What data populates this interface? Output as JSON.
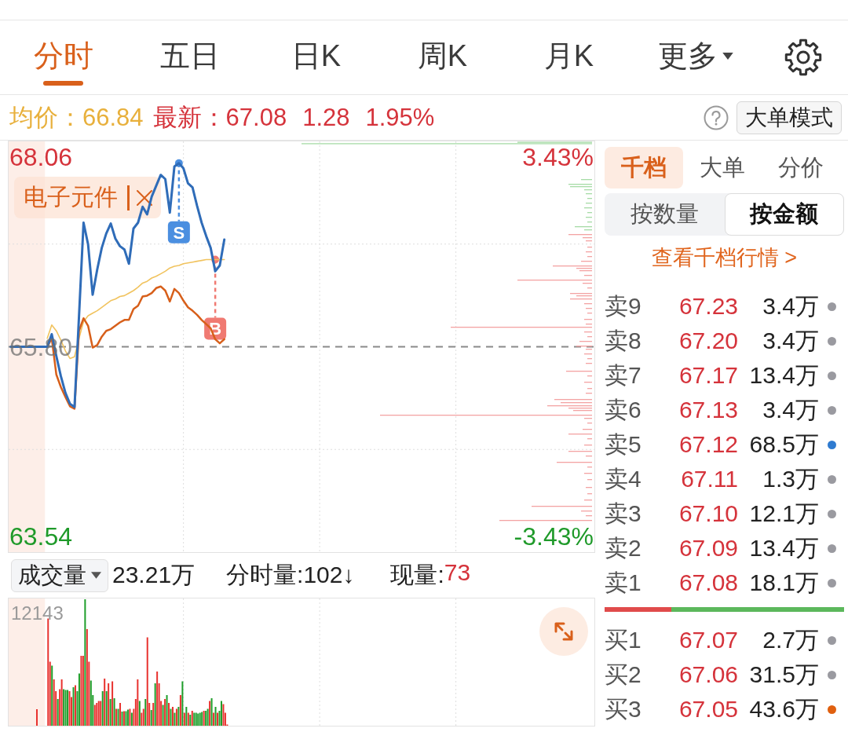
{
  "tabs": [
    {
      "label": "分时",
      "selected": true,
      "kind": "tab"
    },
    {
      "label": "五日",
      "selected": false,
      "kind": "tab"
    },
    {
      "label": "日K",
      "selected": false,
      "kind": "tab"
    },
    {
      "label": "周K",
      "selected": false,
      "kind": "tab"
    },
    {
      "label": "月K",
      "selected": false,
      "kind": "tab"
    },
    {
      "label": "更多",
      "selected": false,
      "kind": "dropdown"
    }
  ],
  "summary": {
    "rising": true,
    "avg_price": "均价：66.84",
    "latest": "最新：67.08",
    "change": "1.28",
    "change_pct": "1.95%",
    "mode_button": "大单模式"
  },
  "chart": {
    "chart_data": {
      "type": "line",
      "categories": [
        null,
        null,
        null,
        null,
        null,
        null,
        null,
        null,
        null,
        null,
        null,
        null,
        null,
        null,
        null,
        null,
        null,
        null,
        null,
        null,
        null,
        null,
        null,
        null,
        null,
        null,
        null,
        null,
        null,
        null,
        null,
        null,
        null,
        null,
        null,
        null,
        null,
        null,
        null,
        null,
        null,
        null,
        null,
        null,
        null,
        null,
        null,
        null,
        null,
        null,
        null,
        null,
        null,
        null,
        null,
        null,
        null,
        null,
        null,
        null,
        null,
        null,
        null,
        null,
        null,
        null,
        null,
        null,
        null,
        null,
        null,
        null,
        null,
        null,
        null,
        null,
        null,
        null,
        null,
        null,
        null,
        null,
        null,
        null,
        null,
        null,
        null,
        null,
        null,
        null,
        null,
        null,
        null,
        null,
        null,
        null,
        null,
        null,
        null,
        null,
        null,
        null,
        null,
        null,
        null,
        null,
        null,
        null,
        null,
        null,
        null,
        null,
        null,
        null,
        null,
        null,
        null,
        null,
        null,
        null,
        null,
        null,
        null,
        null,
        null,
        null,
        null,
        null,
        null
      ],
      "ylim": [
        63.35,
        68.25
      ],
      "yticks": [
        {
          "value": 68.06,
          "label": "68.06"
        },
        {
          "value": 65.8,
          "label": "65.80"
        },
        {
          "value": 63.54,
          "label": "63.54"
        }
      ],
      "ref_lines": [
        {
          "axis": "y",
          "value": 65.8
        }
      ],
      "series": [
        {
          "color": "#2f6cb8",
          "values": [
            65.8,
            65.8,
            65.8,
            65.8,
            65.8,
            65.8,
            65.8,
            65.8,
            65.8,
            65.95,
            65.69,
            65.45,
            65.25,
            65.12,
            65.08,
            66.16,
            67.28,
            67.02,
            66.42,
            66.72,
            66.98,
            67.15,
            67.27,
            67.09,
            67.0,
            66.96,
            66.79,
            67.21,
            67.28,
            67.47,
            67.38,
            67.59,
            67.72,
            67.85,
            67.8,
            67.4,
            67.95,
            67.99,
            67.93,
            67.75,
            67.7,
            67.48,
            67.28,
            67.12,
            66.98,
            66.7,
            66.77,
            67.08,
            null,
            null,
            null,
            null,
            null,
            null,
            null,
            null,
            null,
            null,
            null,
            null,
            null,
            null,
            null,
            null,
            null,
            null,
            null,
            null,
            null,
            null,
            null,
            null,
            null,
            null,
            null,
            null,
            null,
            null,
            null,
            null,
            null,
            null,
            null,
            null,
            null,
            null,
            null,
            null,
            null,
            null,
            null,
            null,
            null,
            null,
            null,
            null,
            null,
            null,
            null,
            null,
            null,
            null,
            null,
            null,
            null,
            null,
            null,
            null,
            null,
            null,
            null,
            null,
            null,
            null,
            null,
            null,
            null,
            null,
            null,
            null,
            null,
            null,
            null,
            null,
            null,
            null,
            null,
            null,
            null
          ]
        },
        {
          "color": "#d75f1a",
          "values": [
            null,
            null,
            null,
            null,
            null,
            null,
            null,
            null,
            65.8,
            65.9,
            65.47,
            65.32,
            65.2,
            65.09,
            65.06,
            65.99,
            66.14,
            66.05,
            65.79,
            65.82,
            65.92,
            65.99,
            66.01,
            66.05,
            66.09,
            66.12,
            66.12,
            66.25,
            66.29,
            66.4,
            66.41,
            66.44,
            66.5,
            66.52,
            66.47,
            66.34,
            66.49,
            66.44,
            66.35,
            66.27,
            66.23,
            66.18,
            66.12,
            66.07,
            66.02,
            65.89,
            65.84,
            65.89,
            null,
            null,
            null,
            null,
            null,
            null,
            null,
            null,
            null,
            null,
            null,
            null,
            null,
            null,
            null,
            null,
            null,
            null,
            null,
            null,
            null,
            null,
            null,
            null,
            null,
            null,
            null,
            null,
            null,
            null,
            null,
            null,
            null,
            null,
            null,
            null,
            null,
            null,
            null,
            null,
            null,
            null,
            null,
            null,
            null,
            null,
            null,
            null,
            null,
            null,
            null,
            null,
            null,
            null,
            null,
            null,
            null,
            null,
            null,
            null,
            null,
            null,
            null,
            null,
            null,
            null,
            null,
            null,
            null,
            null,
            null,
            null,
            null,
            null,
            null,
            null,
            null,
            null,
            null,
            null,
            null
          ]
        },
        {
          "color": "#f1c35e",
          "values": [
            null,
            null,
            null,
            null,
            null,
            null,
            null,
            null,
            65.9,
            66.06,
            65.99,
            65.88,
            65.75,
            65.66,
            65.68,
            65.9,
            66.1,
            66.17,
            66.2,
            66.23,
            66.27,
            66.31,
            66.35,
            66.37,
            66.4,
            66.41,
            66.44,
            66.47,
            66.51,
            66.56,
            66.58,
            66.62,
            66.64,
            66.67,
            66.7,
            66.74,
            66.76,
            66.77,
            66.79,
            66.8,
            66.81,
            66.82,
            66.83,
            66.84,
            66.84,
            66.84,
            66.84,
            66.84,
            null,
            null,
            null,
            null,
            null,
            null,
            null,
            null,
            null,
            null,
            null,
            null,
            null,
            null,
            null,
            null,
            null,
            null,
            null,
            null,
            null,
            null,
            null,
            null,
            null,
            null,
            null,
            null,
            null,
            null,
            null,
            null,
            null,
            null,
            null,
            null,
            null,
            null,
            null,
            null,
            null,
            null,
            null,
            null,
            null,
            null,
            null,
            null,
            null,
            null,
            null,
            null,
            null,
            null,
            null,
            null,
            null,
            null,
            null,
            null,
            null,
            null,
            null,
            null,
            null,
            null,
            null,
            null,
            null,
            null,
            null,
            null,
            null,
            null,
            null,
            null,
            null,
            null,
            null,
            null,
            null
          ]
        }
      ],
      "annotations": [
        "S",
        "B"
      ]
    },
    "percent_labels": [
      "3.43%",
      "-3.43%"
    ],
    "sector_tag": {
      "label": "电子元件"
    }
  },
  "volume": {
    "selector": "成交量",
    "total": "23.21万",
    "minute_volume": "分时量:102↓",
    "current_volume": {
      "label": "现量:",
      "value": "73"
    },
    "max_label": "12143"
  },
  "order_book": {
    "tabs": [
      {
        "label": "千档",
        "selected": true
      },
      {
        "label": "大单",
        "selected": false
      },
      {
        "label": "分价",
        "selected": false
      }
    ],
    "modes": [
      {
        "label": "按数量",
        "selected": false
      },
      {
        "label": "按金额",
        "selected": true
      }
    ],
    "link": "查看千档行情 >",
    "asks": [
      {
        "label": "卖9",
        "price": "67.23",
        "volume": "3.4万",
        "color": "#9a9aa0"
      },
      {
        "label": "卖8",
        "price": "67.20",
        "volume": "3.4万",
        "color": "#9a9aa0"
      },
      {
        "label": "卖7",
        "price": "67.17",
        "volume": "13.4万",
        "color": "#9a9aa0"
      },
      {
        "label": "卖6",
        "price": "67.13",
        "volume": "3.4万",
        "color": "#9a9aa0"
      },
      {
        "label": "卖5",
        "price": "67.12",
        "volume": "68.5万",
        "color": "#2f7bd0"
      },
      {
        "label": "卖4",
        "price": "67.11",
        "volume": "1.3万",
        "color": "#9a9aa0"
      },
      {
        "label": "卖3",
        "price": "67.10",
        "volume": "12.1万",
        "color": "#9a9aa0"
      },
      {
        "label": "卖2",
        "price": "67.09",
        "volume": "13.4万",
        "color": "#9a9aa0"
      },
      {
        "label": "卖1",
        "price": "67.08",
        "volume": "18.1万",
        "color": "#9a9aa0"
      }
    ],
    "balance_bar": {
      "level": 0.28
    },
    "bids": [
      {
        "label": "买1",
        "price": "67.07",
        "volume": "2.7万",
        "color": "#9a9aa0"
      },
      {
        "label": "买2",
        "price": "67.06",
        "volume": "31.5万",
        "color": "#9a9aa0"
      },
      {
        "label": "买3",
        "price": "67.05",
        "volume": "43.6万",
        "color": "#e0600f"
      }
    ]
  }
}
